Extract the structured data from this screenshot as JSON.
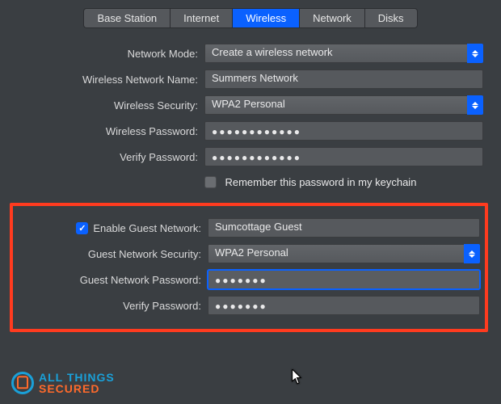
{
  "tabs": [
    {
      "label": "Base Station",
      "active": false
    },
    {
      "label": "Internet",
      "active": false
    },
    {
      "label": "Wireless",
      "active": true
    },
    {
      "label": "Network",
      "active": false
    },
    {
      "label": "Disks",
      "active": false
    }
  ],
  "labels": {
    "networkMode": "Network Mode:",
    "wirelessName": "Wireless Network Name:",
    "wirelessSecurity": "Wireless Security:",
    "wirelessPassword": "Wireless Password:",
    "verifyPassword": "Verify Password:",
    "remember": "Remember this password in my keychain",
    "enableGuest": "Enable Guest Network:",
    "guestSecurity": "Guest Network Security:",
    "guestPassword": "Guest Network Password:",
    "guestVerify": "Verify Password:"
  },
  "values": {
    "networkMode": "Create a wireless network",
    "wirelessName": "Summers Network",
    "wirelessSecurity": "WPA2 Personal",
    "wirelessPassword": "●●●●●●●●●●●●",
    "verifyPassword": "●●●●●●●●●●●●",
    "rememberChecked": false,
    "enableGuestChecked": true,
    "guestName": "Sumcottage Guest",
    "guestSecurity": "WPA2 Personal",
    "guestPassword": "●●●●●●●",
    "guestVerify": "●●●●●●●"
  },
  "watermark": {
    "line1": "ALL THINGS",
    "line2": "SECURED"
  }
}
